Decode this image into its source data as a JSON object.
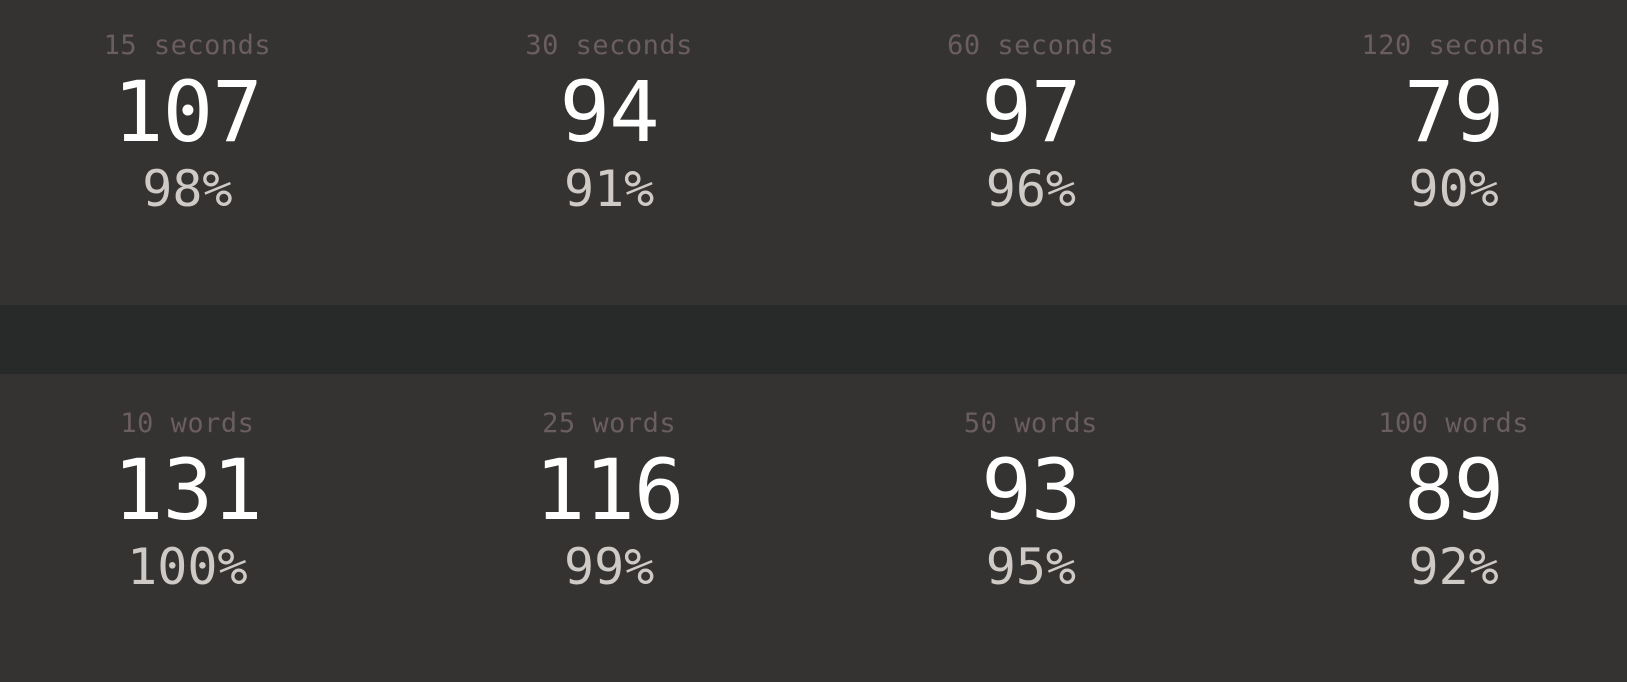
{
  "time_records": [
    {
      "label": "15 seconds",
      "wpm": "107",
      "accuracy": "98%"
    },
    {
      "label": "30 seconds",
      "wpm": "94",
      "accuracy": "91%"
    },
    {
      "label": "60 seconds",
      "wpm": "97",
      "accuracy": "96%"
    },
    {
      "label": "120 seconds",
      "wpm": "79",
      "accuracy": "90%"
    }
  ],
  "word_records": [
    {
      "label": "10 words",
      "wpm": "131",
      "accuracy": "100%"
    },
    {
      "label": "25 words",
      "wpm": "116",
      "accuracy": "99%"
    },
    {
      "label": "50 words",
      "wpm": "93",
      "accuracy": "95%"
    },
    {
      "label": "100 words",
      "wpm": "89",
      "accuracy": "92%"
    }
  ],
  "colors": {
    "page_background": "#282a29",
    "panel_background": "#353331",
    "label_text": "#6b5e60",
    "wpm_text": "#ffffff",
    "accuracy_text": "#cfcac5"
  }
}
